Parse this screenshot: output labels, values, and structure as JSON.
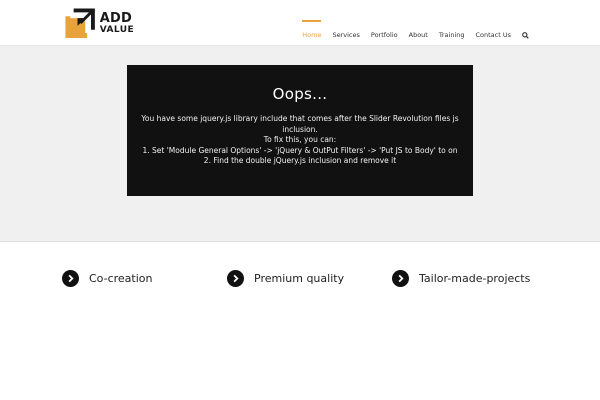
{
  "header": {
    "logo": {
      "line1": "ADD",
      "line2": "VALUE"
    },
    "nav": [
      {
        "label": "Home",
        "active": true
      },
      {
        "label": "Services"
      },
      {
        "label": "Portfolio"
      },
      {
        "label": "About"
      },
      {
        "label": "Training"
      },
      {
        "label": "Contact Us"
      }
    ],
    "search_icon": "search-icon"
  },
  "error": {
    "title": "Oops...",
    "lines": [
      "You have some jquery.js library include that comes after the Slider Revolution files js",
      "inclusion.",
      "To fix this, you can:",
      "1. Set 'Module General Options' -> 'jQuery & OutPut Filters' -> 'Put JS to Body' to on",
      "2. Find the double jQuery.js inclusion and remove it"
    ]
  },
  "features": [
    {
      "label": "Co-creation",
      "icon": "chevron-right-circle-icon"
    },
    {
      "label": "Premium quality",
      "icon": "chevron-right-circle-icon"
    },
    {
      "label": "Tailor-made-projects",
      "icon": "chevron-right-circle-icon"
    }
  ],
  "colors": {
    "accent": "#e8a33a",
    "error_bg": "#111111",
    "hero_bg": "#f0f0f0"
  }
}
